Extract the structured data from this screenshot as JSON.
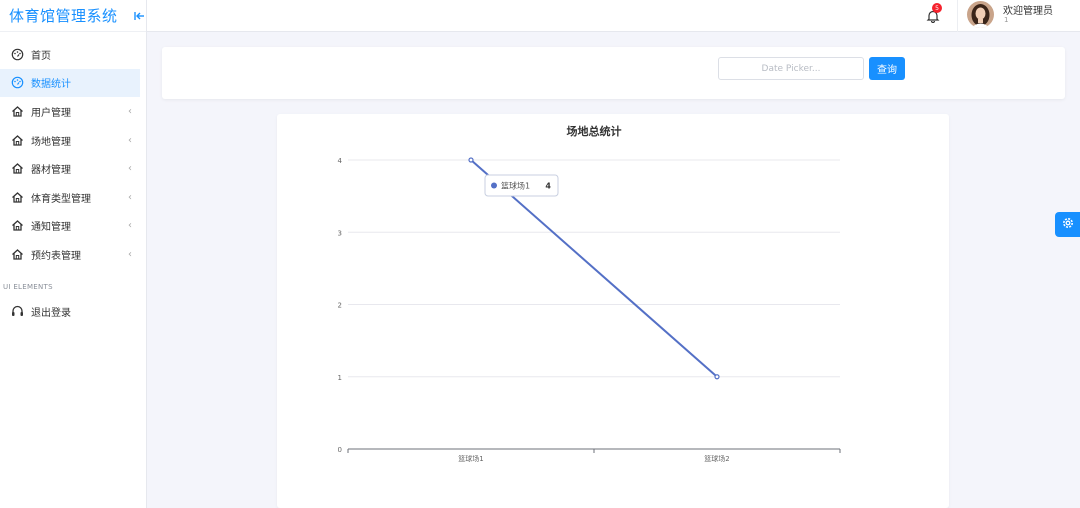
{
  "app": {
    "title": "体育馆管理系统"
  },
  "sidebar": {
    "items": [
      {
        "label": "首页",
        "icon": "dashboard-icon",
        "active": false,
        "expandable": false
      },
      {
        "label": "数据统计",
        "icon": "dashboard-icon",
        "active": true,
        "expandable": false
      },
      {
        "label": "用户管理",
        "icon": "home-icon",
        "active": false,
        "expandable": true
      },
      {
        "label": "场地管理",
        "icon": "home-icon",
        "active": false,
        "expandable": true
      },
      {
        "label": "器材管理",
        "icon": "home-icon",
        "active": false,
        "expandable": true
      },
      {
        "label": "体育类型管理",
        "icon": "home-icon",
        "active": false,
        "expandable": true
      },
      {
        "label": "通知管理",
        "icon": "home-icon",
        "active": false,
        "expandable": true
      },
      {
        "label": "预约表管理",
        "icon": "home-icon",
        "active": false,
        "expandable": true
      }
    ],
    "section_label": "UI ELEMENTS",
    "logout_label": "退出登录",
    "logout_icon": "headset-icon"
  },
  "header": {
    "notification_count": "5",
    "welcome_text": "欢迎管理员",
    "user_sub": "1"
  },
  "filter": {
    "date_placeholder": "Date Picker...",
    "query_label": "查询"
  },
  "chart_data": {
    "type": "line",
    "title": "场地总统计",
    "categories": [
      "篮球场1",
      "篮球场2"
    ],
    "values": [
      4,
      1
    ],
    "ylim": [
      0,
      4
    ],
    "yticks": [
      0,
      1,
      2,
      3,
      4
    ],
    "grid": true,
    "color": "#5470c6",
    "tooltip": {
      "category": "篮球场1",
      "value": 4
    }
  },
  "colors": {
    "accent": "#1890ff",
    "badge": "#f5222d"
  }
}
